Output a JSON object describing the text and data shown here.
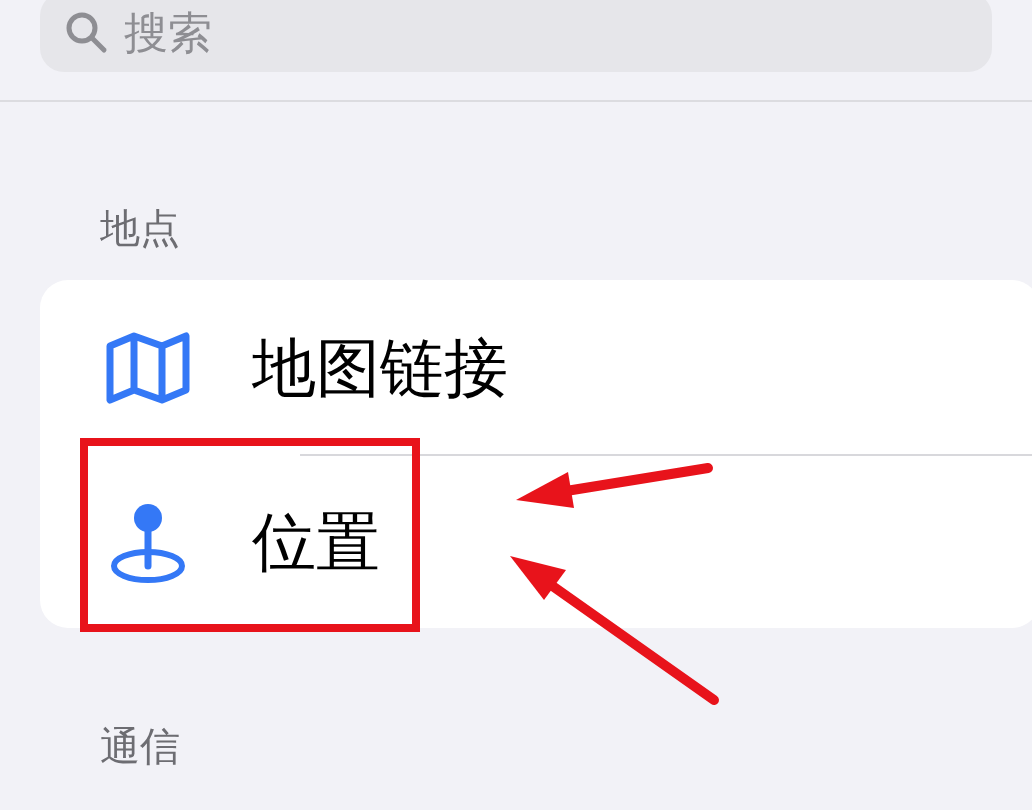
{
  "search": {
    "placeholder": "搜索"
  },
  "sections": [
    {
      "header": "地点",
      "items": [
        {
          "label": "地图链接",
          "kind": "map",
          "highlighted": false
        },
        {
          "label": "位置",
          "kind": "pin",
          "highlighted": true
        }
      ]
    },
    {
      "header": "通信"
    }
  ]
}
